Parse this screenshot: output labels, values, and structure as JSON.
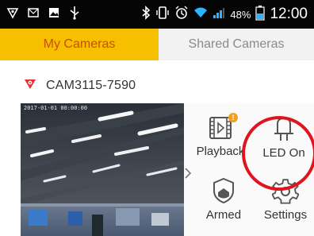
{
  "status_bar": {
    "battery_percent": "48%",
    "time": "12:00",
    "icons": [
      "shield-icon",
      "mail-icon",
      "image-icon",
      "usb-icon",
      "bluetooth-icon",
      "vibrate-icon",
      "alarm-icon",
      "wifi-icon",
      "signal-icon",
      "battery-icon"
    ]
  },
  "tabs": [
    {
      "label": "My Cameras",
      "active": true
    },
    {
      "label": "Shared Cameras",
      "active": false
    }
  ],
  "camera": {
    "name": "CAM3115-7590",
    "icon": "camera-icon",
    "video_timestamp": "2017-01-01 00:00:00"
  },
  "actions": {
    "playback": {
      "label": "Playback",
      "icon": "playback-icon",
      "badge": "!"
    },
    "led": {
      "label": "LED On",
      "icon": "led-icon"
    },
    "armed": {
      "label": "Armed",
      "icon": "shield-icon"
    },
    "settings": {
      "label": "Settings",
      "icon": "gear-icon"
    }
  },
  "colors": {
    "accent": "#f6c000",
    "active_tab_text": "#c85000",
    "highlight": "#e0141e",
    "badge": "#f0a020"
  }
}
